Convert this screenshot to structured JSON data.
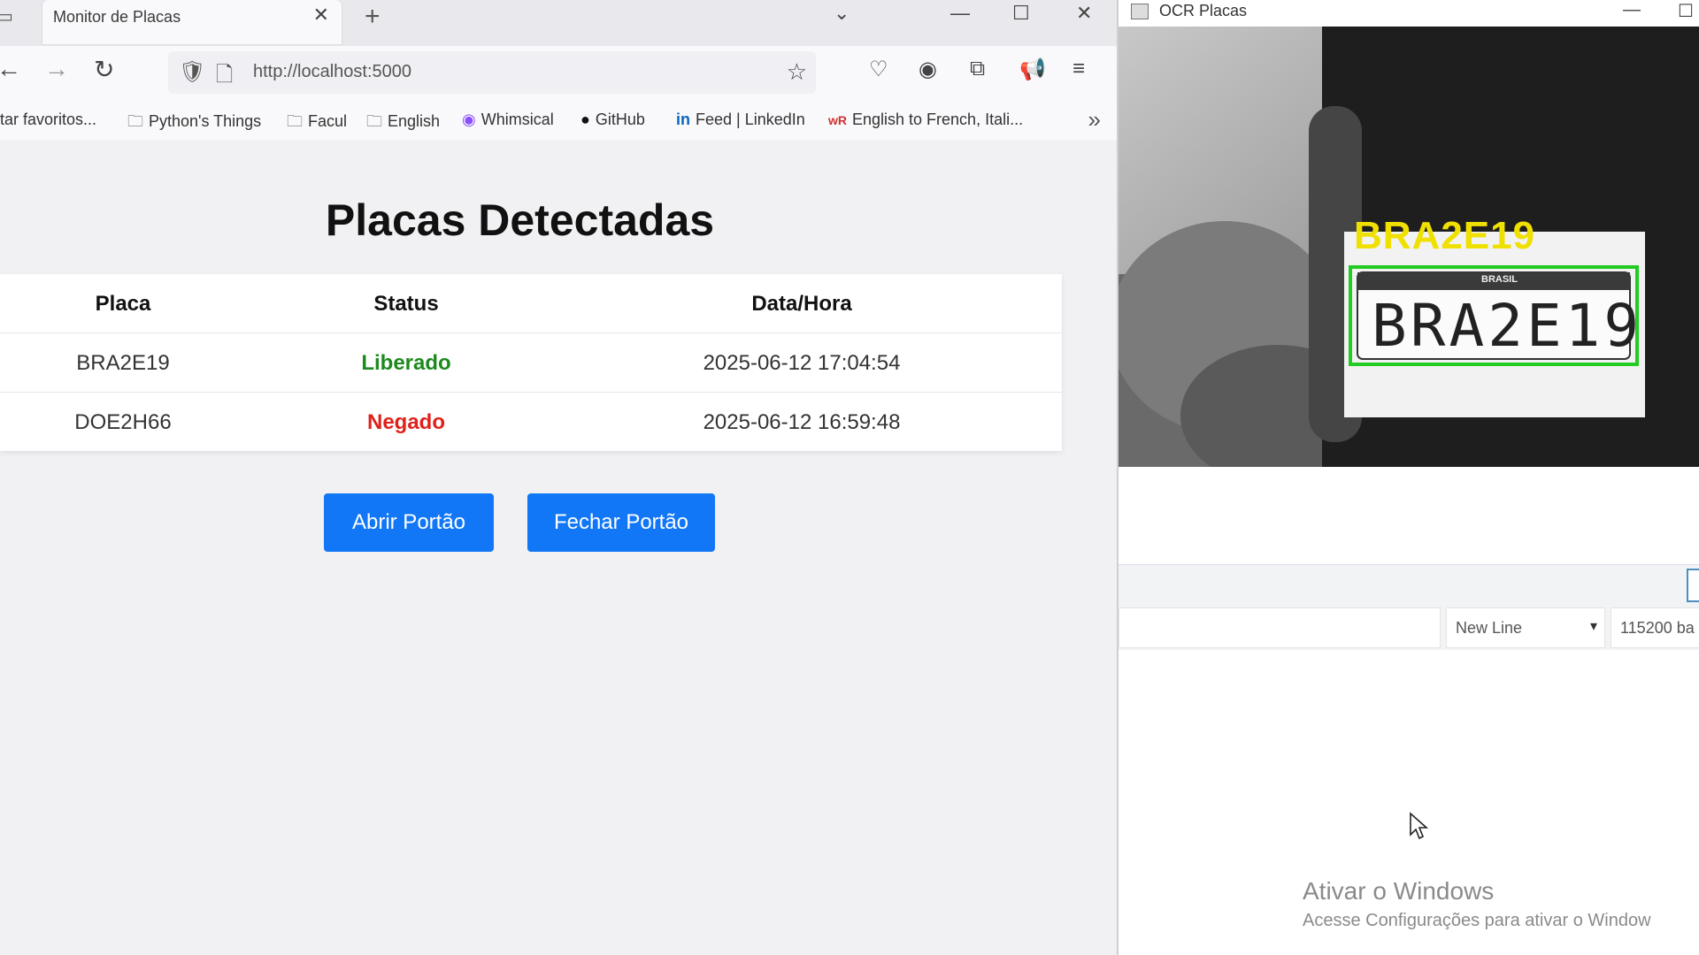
{
  "browser": {
    "tab": {
      "title": "Monitor de Placas",
      "close_glyph": "✕"
    },
    "new_tab_glyph": "+",
    "url": "http://localhost:5000",
    "bookmarks": [
      {
        "label": "rtar favoritos...",
        "icon": ""
      },
      {
        "label": "Python's Things",
        "icon": "folder-icon"
      },
      {
        "label": "Facul",
        "icon": "folder-icon"
      },
      {
        "label": "English",
        "icon": "folder-icon"
      },
      {
        "label": "Whimsical",
        "icon": "whimsical-icon"
      },
      {
        "label": "GitHub",
        "icon": "github-icon"
      },
      {
        "label": "Feed | LinkedIn",
        "icon": "linkedin-icon"
      },
      {
        "label": "English to French, Itali...",
        "icon": "wordreference-icon"
      }
    ]
  },
  "page": {
    "title": "Placas Detectadas",
    "table": {
      "headers": [
        "Placa",
        "Status",
        "Data/Hora"
      ],
      "rows": [
        {
          "placa": "BRA2E19",
          "status": "Liberado",
          "datahora": "2025-06-12 17:04:54"
        },
        {
          "placa": "DOE2H66",
          "status": "Negado",
          "datahora": "2025-06-12 16:59:48"
        }
      ]
    },
    "buttons": {
      "open": "Abrir Portão",
      "close": "Fechar Portão"
    },
    "colors": {
      "button": "#1177f7",
      "liberado": "#1c8a1c",
      "negado": "#e0201a"
    }
  },
  "ocr_window": {
    "title": "OCR Placas",
    "detected_label": "BRA2E19",
    "plate_text": "BRA2E19",
    "plate_header": "BRASIL",
    "colors": {
      "label": "#f0e000",
      "box": "#22cc22"
    }
  },
  "serial": {
    "line_ending": "New Line",
    "baud": "115200 ba"
  },
  "watermark": {
    "line1": "Ativar o Windows",
    "line2": "Acesse Configurações para ativar o Window"
  }
}
